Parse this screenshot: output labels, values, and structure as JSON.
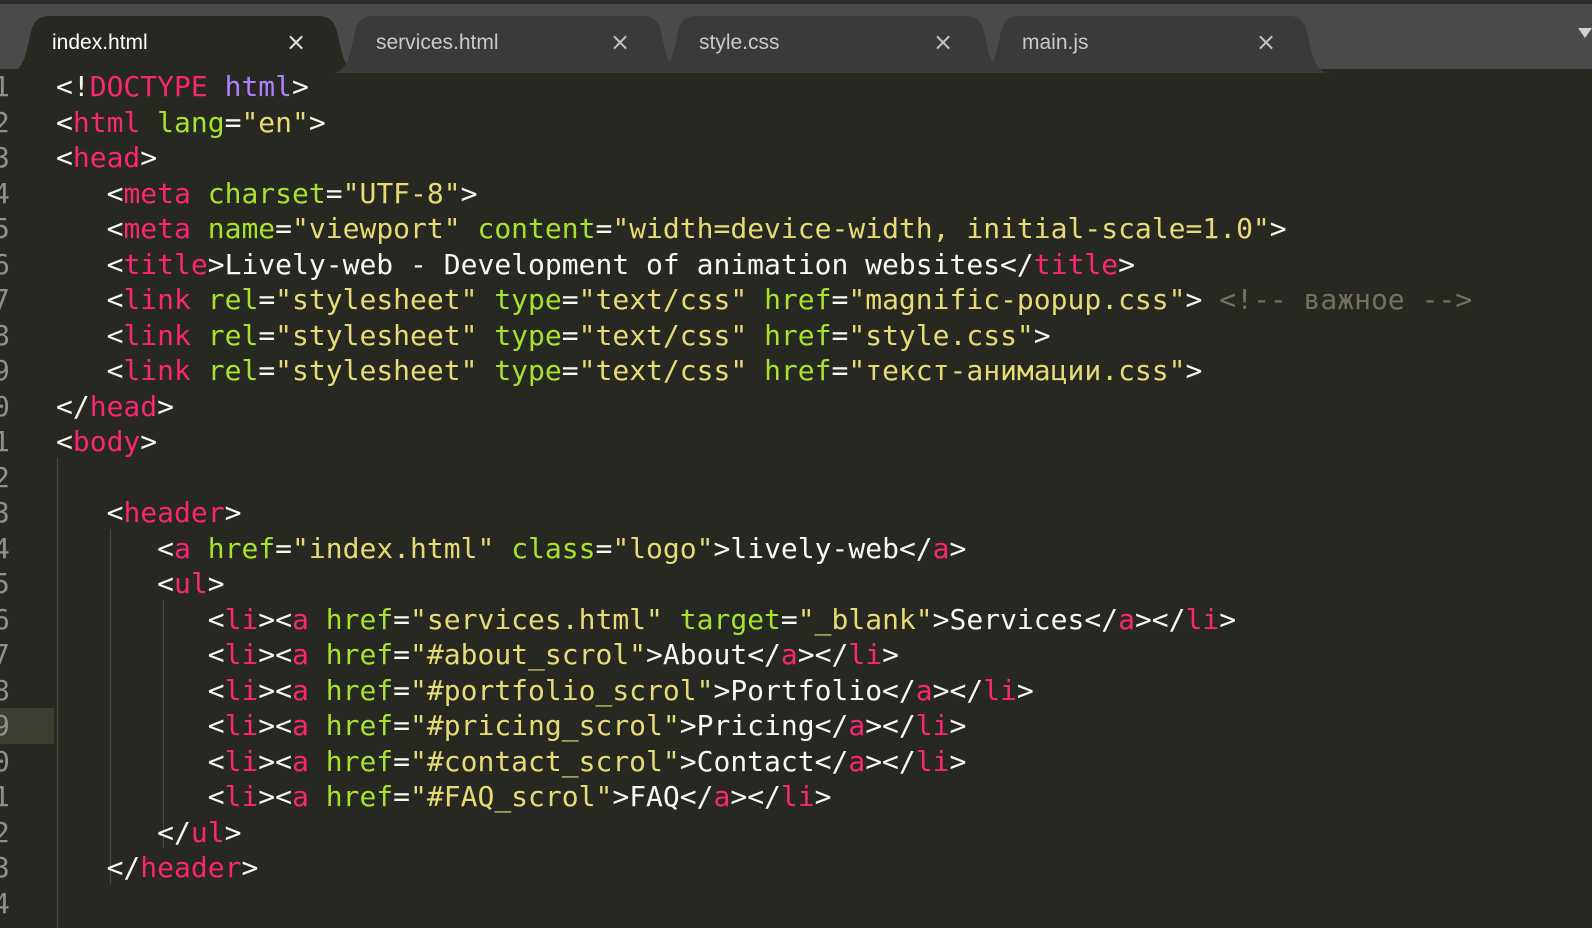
{
  "tabs": [
    {
      "label": "index.html",
      "active": true
    },
    {
      "label": "services.html",
      "active": false
    },
    {
      "label": "style.css",
      "active": false
    },
    {
      "label": "main.js",
      "active": false
    }
  ],
  "tab_close_glyph": "×",
  "colors": {
    "background": "#272822",
    "tag": "#f92672",
    "attribute": "#a6e22e",
    "string": "#e6db74",
    "keyword": "#ae81ff",
    "comment": "#75715e",
    "text": "#f8f8f2",
    "line_number": "#90908a"
  },
  "current_line": 19,
  "lines": [
    {
      "n": "1",
      "tokens": [
        [
          "punc",
          "<!"
        ],
        [
          "tag",
          "DOCTYPE"
        ],
        [
          "txt",
          " "
        ],
        [
          "kw",
          "html"
        ],
        [
          "punc",
          ">"
        ]
      ]
    },
    {
      "n": "2",
      "tokens": [
        [
          "punc",
          "<"
        ],
        [
          "tag",
          "html"
        ],
        [
          "txt",
          " "
        ],
        [
          "attr",
          "lang"
        ],
        [
          "punc",
          "="
        ],
        [
          "str",
          "\"en\""
        ],
        [
          "punc",
          ">"
        ]
      ]
    },
    {
      "n": "3",
      "tokens": [
        [
          "punc",
          "<"
        ],
        [
          "tag",
          "head"
        ],
        [
          "punc",
          ">"
        ]
      ]
    },
    {
      "n": "4",
      "tokens": [
        [
          "txt",
          "   "
        ],
        [
          "punc",
          "<"
        ],
        [
          "tag",
          "meta"
        ],
        [
          "txt",
          " "
        ],
        [
          "attr",
          "charset"
        ],
        [
          "punc",
          "="
        ],
        [
          "str",
          "\"UTF-8\""
        ],
        [
          "punc",
          ">"
        ]
      ]
    },
    {
      "n": "5",
      "tokens": [
        [
          "txt",
          "   "
        ],
        [
          "punc",
          "<"
        ],
        [
          "tag",
          "meta"
        ],
        [
          "txt",
          " "
        ],
        [
          "attr",
          "name"
        ],
        [
          "punc",
          "="
        ],
        [
          "str",
          "\"viewport\""
        ],
        [
          "txt",
          " "
        ],
        [
          "attr",
          "content"
        ],
        [
          "punc",
          "="
        ],
        [
          "str",
          "\"width=device-width, initial-scale=1.0\""
        ],
        [
          "punc",
          ">"
        ]
      ]
    },
    {
      "n": "6",
      "tokens": [
        [
          "txt",
          "   "
        ],
        [
          "punc",
          "<"
        ],
        [
          "tag",
          "title"
        ],
        [
          "punc",
          ">"
        ],
        [
          "txt",
          "Lively-web - Development of animation websites"
        ],
        [
          "punc",
          "</"
        ],
        [
          "tag",
          "title"
        ],
        [
          "punc",
          ">"
        ]
      ]
    },
    {
      "n": "7",
      "tokens": [
        [
          "txt",
          "   "
        ],
        [
          "punc",
          "<"
        ],
        [
          "tag",
          "link"
        ],
        [
          "txt",
          " "
        ],
        [
          "attr",
          "rel"
        ],
        [
          "punc",
          "="
        ],
        [
          "str",
          "\"stylesheet\""
        ],
        [
          "txt",
          " "
        ],
        [
          "attr",
          "type"
        ],
        [
          "punc",
          "="
        ],
        [
          "str",
          "\"text/css\""
        ],
        [
          "txt",
          " "
        ],
        [
          "attr",
          "href"
        ],
        [
          "punc",
          "="
        ],
        [
          "str",
          "\"magnific-popup.css\""
        ],
        [
          "punc",
          ">"
        ],
        [
          "txt",
          " "
        ],
        [
          "cmt",
          "<!-- важное -->"
        ]
      ]
    },
    {
      "n": "8",
      "tokens": [
        [
          "txt",
          "   "
        ],
        [
          "punc",
          "<"
        ],
        [
          "tag",
          "link"
        ],
        [
          "txt",
          " "
        ],
        [
          "attr",
          "rel"
        ],
        [
          "punc",
          "="
        ],
        [
          "str",
          "\"stylesheet\""
        ],
        [
          "txt",
          " "
        ],
        [
          "attr",
          "type"
        ],
        [
          "punc",
          "="
        ],
        [
          "str",
          "\"text/css\""
        ],
        [
          "txt",
          " "
        ],
        [
          "attr",
          "href"
        ],
        [
          "punc",
          "="
        ],
        [
          "str",
          "\"style.css\""
        ],
        [
          "punc",
          ">"
        ]
      ]
    },
    {
      "n": "9",
      "tokens": [
        [
          "txt",
          "   "
        ],
        [
          "punc",
          "<"
        ],
        [
          "tag",
          "link"
        ],
        [
          "txt",
          " "
        ],
        [
          "attr",
          "rel"
        ],
        [
          "punc",
          "="
        ],
        [
          "str",
          "\"stylesheet\""
        ],
        [
          "txt",
          " "
        ],
        [
          "attr",
          "type"
        ],
        [
          "punc",
          "="
        ],
        [
          "str",
          "\"text/css\""
        ],
        [
          "txt",
          " "
        ],
        [
          "attr",
          "href"
        ],
        [
          "punc",
          "="
        ],
        [
          "str",
          "\"текст-анимации.css\""
        ],
        [
          "punc",
          ">"
        ]
      ]
    },
    {
      "n": "0",
      "tokens": [
        [
          "punc",
          "</"
        ],
        [
          "tag",
          "head"
        ],
        [
          "punc",
          ">"
        ]
      ]
    },
    {
      "n": "1",
      "tokens": [
        [
          "punc",
          "<"
        ],
        [
          "tag",
          "body"
        ],
        [
          "punc",
          ">"
        ]
      ]
    },
    {
      "n": "2",
      "tokens": []
    },
    {
      "n": "3",
      "tokens": [
        [
          "txt",
          "   "
        ],
        [
          "punc",
          "<"
        ],
        [
          "tag",
          "header"
        ],
        [
          "punc",
          ">"
        ]
      ]
    },
    {
      "n": "4",
      "tokens": [
        [
          "txt",
          "      "
        ],
        [
          "punc",
          "<"
        ],
        [
          "tag",
          "a"
        ],
        [
          "txt",
          " "
        ],
        [
          "attr",
          "href"
        ],
        [
          "punc",
          "="
        ],
        [
          "str",
          "\"index.html\""
        ],
        [
          "txt",
          " "
        ],
        [
          "attr",
          "class"
        ],
        [
          "punc",
          "="
        ],
        [
          "str",
          "\"logo\""
        ],
        [
          "punc",
          ">"
        ],
        [
          "txt",
          "lively-web"
        ],
        [
          "punc",
          "</"
        ],
        [
          "tag",
          "a"
        ],
        [
          "punc",
          ">"
        ]
      ]
    },
    {
      "n": "5",
      "tokens": [
        [
          "txt",
          "      "
        ],
        [
          "punc",
          "<"
        ],
        [
          "tag",
          "ul"
        ],
        [
          "punc",
          ">"
        ]
      ]
    },
    {
      "n": "6",
      "tokens": [
        [
          "txt",
          "         "
        ],
        [
          "punc",
          "<"
        ],
        [
          "tag",
          "li"
        ],
        [
          "punc",
          "><"
        ],
        [
          "tag",
          "a"
        ],
        [
          "txt",
          " "
        ],
        [
          "attr",
          "href"
        ],
        [
          "punc",
          "="
        ],
        [
          "str",
          "\"services.html\""
        ],
        [
          "txt",
          " "
        ],
        [
          "attr",
          "target"
        ],
        [
          "punc",
          "="
        ],
        [
          "str",
          "\"_blank\""
        ],
        [
          "punc",
          ">"
        ],
        [
          "txt",
          "Services"
        ],
        [
          "punc",
          "</"
        ],
        [
          "tag",
          "a"
        ],
        [
          "punc",
          "></"
        ],
        [
          "tag",
          "li"
        ],
        [
          "punc",
          ">"
        ]
      ]
    },
    {
      "n": "7",
      "tokens": [
        [
          "txt",
          "         "
        ],
        [
          "punc",
          "<"
        ],
        [
          "tag",
          "li"
        ],
        [
          "punc",
          "><"
        ],
        [
          "tag",
          "a"
        ],
        [
          "txt",
          " "
        ],
        [
          "attr",
          "href"
        ],
        [
          "punc",
          "="
        ],
        [
          "str",
          "\"#about_scrol\""
        ],
        [
          "punc",
          ">"
        ],
        [
          "txt",
          "About"
        ],
        [
          "punc",
          "</"
        ],
        [
          "tag",
          "a"
        ],
        [
          "punc",
          "></"
        ],
        [
          "tag",
          "li"
        ],
        [
          "punc",
          ">"
        ]
      ]
    },
    {
      "n": "8",
      "tokens": [
        [
          "txt",
          "         "
        ],
        [
          "punc",
          "<"
        ],
        [
          "tag",
          "li"
        ],
        [
          "punc",
          "><"
        ],
        [
          "tag",
          "a"
        ],
        [
          "txt",
          " "
        ],
        [
          "attr",
          "href"
        ],
        [
          "punc",
          "="
        ],
        [
          "str",
          "\"#portfolio_scrol\""
        ],
        [
          "punc",
          ">"
        ],
        [
          "txt",
          "Portfolio"
        ],
        [
          "punc",
          "</"
        ],
        [
          "tag",
          "a"
        ],
        [
          "punc",
          "></"
        ],
        [
          "tag",
          "li"
        ],
        [
          "punc",
          ">"
        ]
      ]
    },
    {
      "n": "9",
      "tokens": [
        [
          "txt",
          "         "
        ],
        [
          "punc",
          "<"
        ],
        [
          "tag",
          "li"
        ],
        [
          "punc",
          "><"
        ],
        [
          "tag",
          "a"
        ],
        [
          "txt",
          " "
        ],
        [
          "attr",
          "href"
        ],
        [
          "punc",
          "="
        ],
        [
          "str",
          "\"#pricing_scrol\""
        ],
        [
          "punc",
          ">"
        ],
        [
          "txt",
          "Pricing"
        ],
        [
          "punc",
          "</"
        ],
        [
          "tag",
          "a"
        ],
        [
          "punc",
          "></"
        ],
        [
          "tag",
          "li"
        ],
        [
          "punc",
          ">"
        ]
      ]
    },
    {
      "n": "0",
      "tokens": [
        [
          "txt",
          "         "
        ],
        [
          "punc",
          "<"
        ],
        [
          "tag",
          "li"
        ],
        [
          "punc",
          "><"
        ],
        [
          "tag",
          "a"
        ],
        [
          "txt",
          " "
        ],
        [
          "attr",
          "href"
        ],
        [
          "punc",
          "="
        ],
        [
          "str",
          "\"#contact_scrol\""
        ],
        [
          "punc",
          ">"
        ],
        [
          "txt",
          "Contact"
        ],
        [
          "punc",
          "</"
        ],
        [
          "tag",
          "a"
        ],
        [
          "punc",
          "></"
        ],
        [
          "tag",
          "li"
        ],
        [
          "punc",
          ">"
        ]
      ]
    },
    {
      "n": "1",
      "tokens": [
        [
          "txt",
          "         "
        ],
        [
          "punc",
          "<"
        ],
        [
          "tag",
          "li"
        ],
        [
          "punc",
          "><"
        ],
        [
          "tag",
          "a"
        ],
        [
          "txt",
          " "
        ],
        [
          "attr",
          "href"
        ],
        [
          "punc",
          "="
        ],
        [
          "str",
          "\"#FAQ_scrol\""
        ],
        [
          "punc",
          ">"
        ],
        [
          "txt",
          "FAQ"
        ],
        [
          "punc",
          "</"
        ],
        [
          "tag",
          "a"
        ],
        [
          "punc",
          "></"
        ],
        [
          "tag",
          "li"
        ],
        [
          "punc",
          ">"
        ]
      ]
    },
    {
      "n": "2",
      "tokens": [
        [
          "txt",
          "      "
        ],
        [
          "punc",
          "</"
        ],
        [
          "tag",
          "ul"
        ],
        [
          "punc",
          ">"
        ]
      ]
    },
    {
      "n": "3",
      "tokens": [
        [
          "txt",
          "   "
        ],
        [
          "punc",
          "</"
        ],
        [
          "tag",
          "header"
        ],
        [
          "punc",
          ">"
        ]
      ]
    },
    {
      "n": "4",
      "tokens": []
    }
  ]
}
